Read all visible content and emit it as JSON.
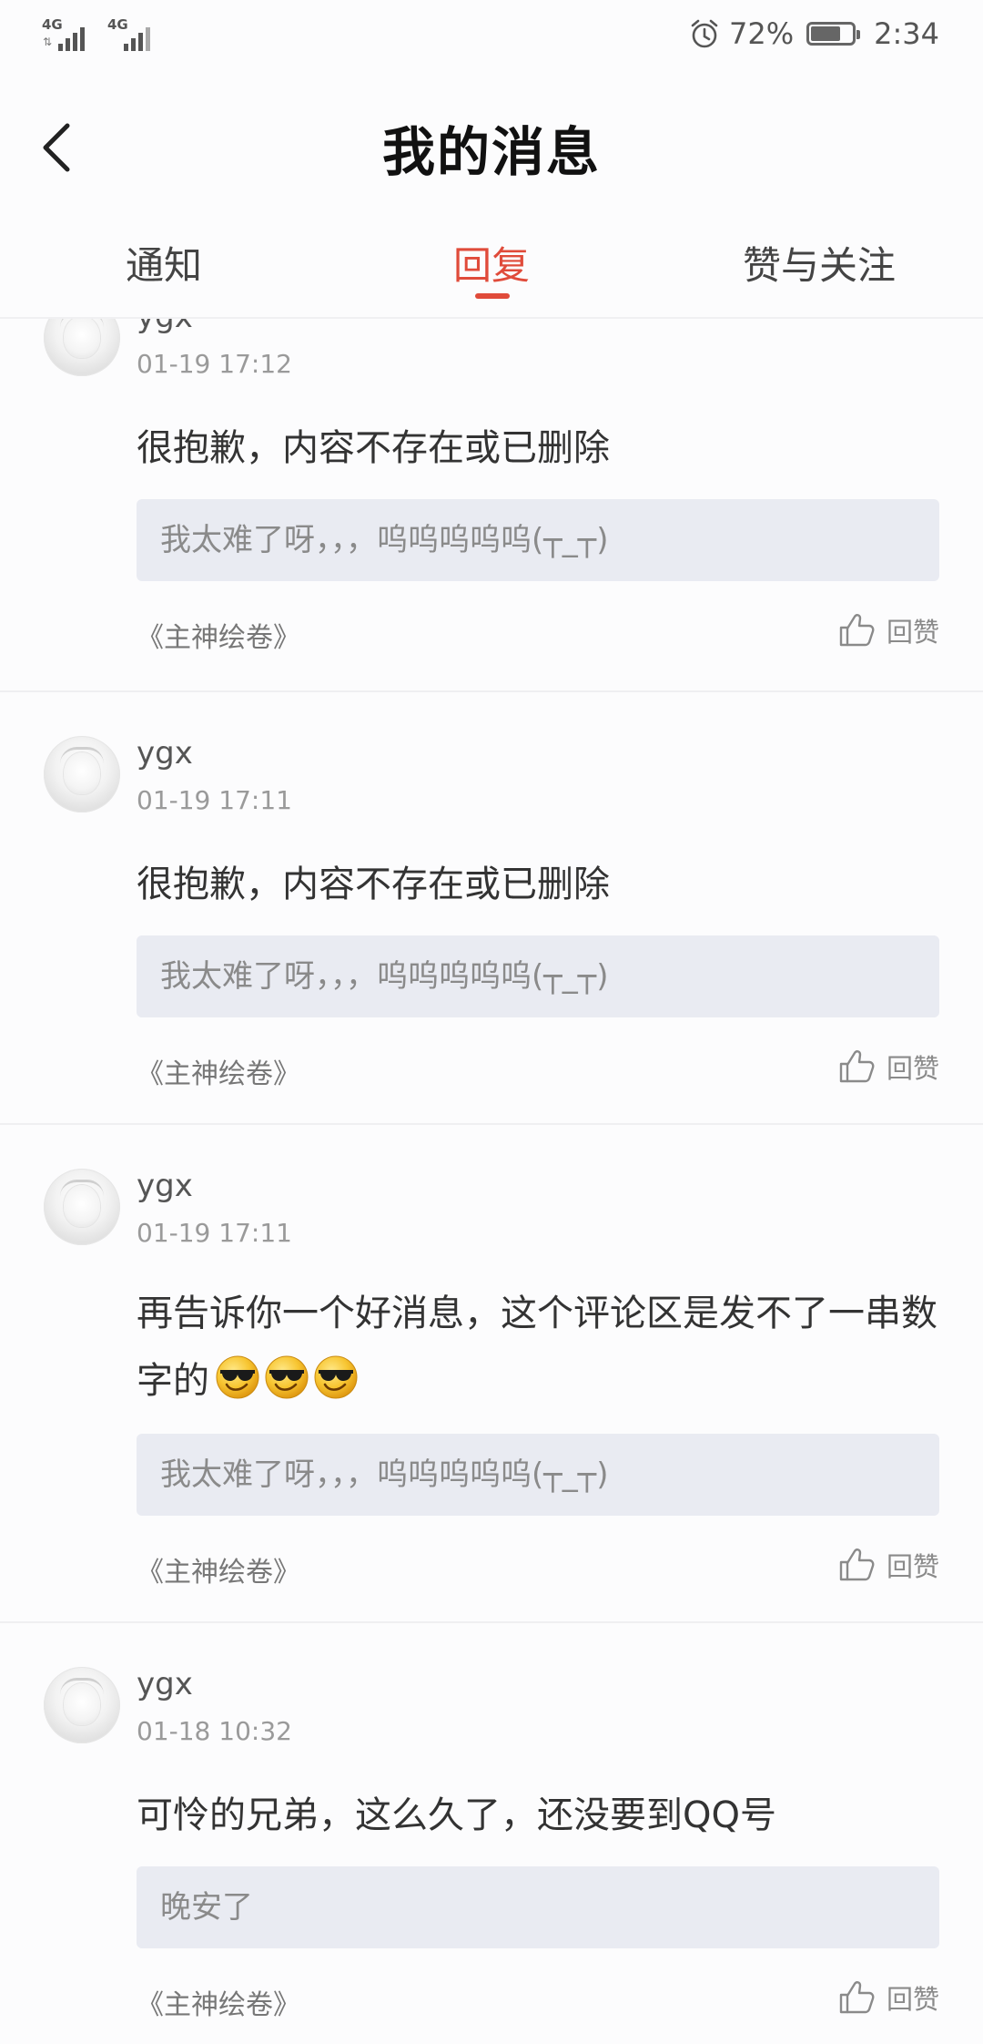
{
  "status_bar": {
    "network_1": "4G",
    "network_2": "4G",
    "battery": "72%",
    "battery_level": 0.72,
    "time": "2:34"
  },
  "header": {
    "title": "我的消息"
  },
  "tabs": [
    {
      "label": "通知",
      "active": false
    },
    {
      "label": "回复",
      "active": true
    },
    {
      "label": "赞与关注",
      "active": false
    }
  ],
  "messages": [
    {
      "username": "ygx",
      "time": "01-19 17:12",
      "content": "很抱歉，内容不存在或已删除",
      "quote": "我太难了呀，，，呜呜呜呜呜(┬_┬)",
      "source": "《主神绘卷》",
      "like_label": "回赞"
    },
    {
      "username": "ygx",
      "time": "01-19 17:11",
      "content": "很抱歉，内容不存在或已删除",
      "quote": "我太难了呀，，，呜呜呜呜呜(┬_┬)",
      "source": "《主神绘卷》",
      "like_label": "回赞"
    },
    {
      "username": "ygx",
      "time": "01-19 17:11",
      "content": "再告诉你一个好消息，这个评论区是发不了一串数字的",
      "emoji": [
        "sunglasses-smiley",
        "sunglasses-smiley",
        "sunglasses-smiley"
      ],
      "quote": "我太难了呀，，，呜呜呜呜呜(┬_┬)",
      "source": "《主神绘卷》",
      "like_label": "回赞"
    },
    {
      "username": "ygx",
      "time": "01-18 10:32",
      "content": "可怜的兄弟，这么久了，还没要到QQ号",
      "quote": "晚安了",
      "source": "《主神绘卷》",
      "like_label": "回赞"
    }
  ],
  "colors": {
    "accent": "#e04b3a",
    "quote_bg": "#e9ebf2",
    "text": "#333333",
    "muted": "#9a9a9a"
  }
}
